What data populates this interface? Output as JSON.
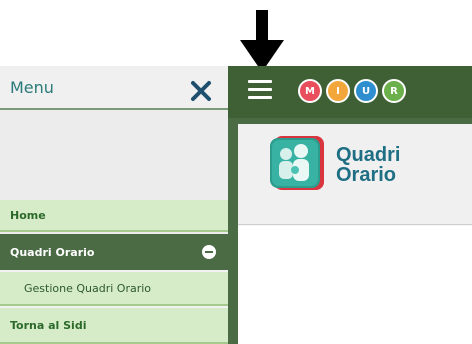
{
  "sidebar": {
    "title": "Menu",
    "items": [
      {
        "label": "Home"
      },
      {
        "label": "Quadri Orario"
      },
      {
        "label": "Gestione Quadri Orario"
      },
      {
        "label": "Torna al Sidi"
      }
    ]
  },
  "topbar": {
    "logo_letters": [
      "M",
      "I",
      "U",
      "R"
    ],
    "logo_colors": [
      "#e84e5b",
      "#f3a63a",
      "#2e8ed0",
      "#6bb04a"
    ]
  },
  "app": {
    "title_line1": "Quadri",
    "title_line2": "Orario"
  },
  "colors": {
    "dark_green": "#3f5f35",
    "light_green": "#d6ebc8",
    "teal_text": "#1f6f84"
  }
}
